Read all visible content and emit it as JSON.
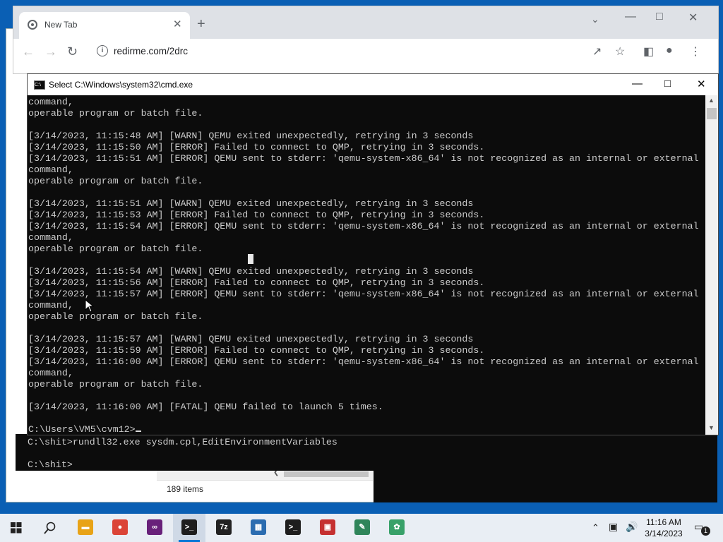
{
  "browser": {
    "tab_title": "New Tab",
    "url": "redirme.com/2drc"
  },
  "cmd_main": {
    "title": "Select C:\\Windows\\system32\\cmd.exe",
    "lines": [
      "command,",
      "operable program or batch file.",
      "",
      "[3/14/2023, 11:15:48 AM] [WARN] QEMU exited unexpectedly, retrying in 3 seconds",
      "[3/14/2023, 11:15:50 AM] [ERROR] Failed to connect to QMP, retrying in 3 seconds.",
      "[3/14/2023, 11:15:51 AM] [ERROR] QEMU sent to stderr: 'qemu-system-x86_64' is not recognized as an internal or external",
      "command,",
      "operable program or batch file.",
      "",
      "[3/14/2023, 11:15:51 AM] [WARN] QEMU exited unexpectedly, retrying in 3 seconds",
      "[3/14/2023, 11:15:53 AM] [ERROR] Failed to connect to QMP, retrying in 3 seconds.",
      "[3/14/2023, 11:15:54 AM] [ERROR] QEMU sent to stderr: 'qemu-system-x86_64' is not recognized as an internal or external",
      "command,",
      "operable program or batch file.",
      "",
      "[3/14/2023, 11:15:54 AM] [WARN] QEMU exited unexpectedly, retrying in 3 seconds",
      "[3/14/2023, 11:15:56 AM] [ERROR] Failed to connect to QMP, retrying in 3 seconds.",
      "[3/14/2023, 11:15:57 AM] [ERROR] QEMU sent to stderr: 'qemu-system-x86_64' is not recognized as an internal or external",
      "command,",
      "operable program or batch file.",
      "",
      "[3/14/2023, 11:15:57 AM] [WARN] QEMU exited unexpectedly, retrying in 3 seconds",
      "[3/14/2023, 11:15:59 AM] [ERROR] Failed to connect to QMP, retrying in 3 seconds.",
      "[3/14/2023, 11:16:00 AM] [ERROR] QEMU sent to stderr: 'qemu-system-x86_64' is not recognized as an internal or external",
      "command,",
      "operable program or batch file.",
      "",
      "[3/14/2023, 11:16:00 AM] [FATAL] QEMU failed to launch 5 times.",
      "",
      "C:\\Users\\VM5\\cvm12>"
    ]
  },
  "cmd_background": {
    "lines": [
      "C:\\shit>rundll32.exe sysdm.cpl,EditEnvironmentVariables",
      "",
      "C:\\shit>"
    ]
  },
  "explorer": {
    "status": "189 items"
  },
  "taskbar": {
    "time": "11:16 AM",
    "date": "3/14/2023",
    "notification_count": "1",
    "apps": [
      {
        "name": "File Explorer",
        "icon": "folder-icon",
        "color": "#e8a317"
      },
      {
        "name": "Google Chrome",
        "icon": "chrome-icon",
        "color": "#db4437"
      },
      {
        "name": "Visual Studio",
        "icon": "visual-studio-icon",
        "color": "#68217a"
      },
      {
        "name": "Command Prompt",
        "icon": "cmd-icon",
        "color": "#1e1e1e"
      },
      {
        "name": "7-Zip",
        "icon": "7zip-icon",
        "color": "#222222"
      },
      {
        "name": "Control Panel",
        "icon": "control-panel-icon",
        "color": "#2b6cb0"
      },
      {
        "name": "Command Prompt 2",
        "icon": "cmd-icon",
        "color": "#1e1e1e"
      },
      {
        "name": "Toolbox",
        "icon": "toolbox-icon",
        "color": "#c53030"
      },
      {
        "name": "Notepad++",
        "icon": "notepad-icon",
        "color": "#2f855a"
      },
      {
        "name": "Frog App",
        "icon": "frog-icon",
        "color": "#38a169"
      }
    ]
  }
}
